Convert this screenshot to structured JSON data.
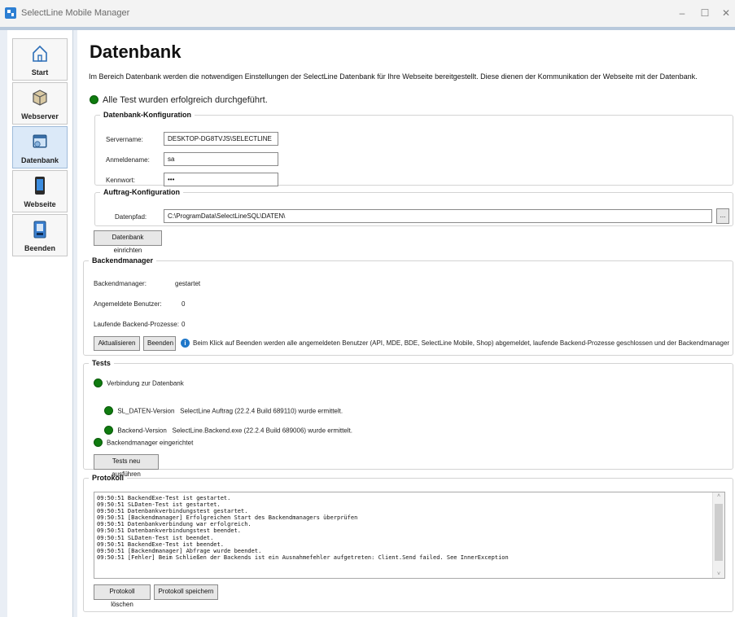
{
  "window": {
    "title": "SelectLine Mobile Manager",
    "minimize": "–",
    "maximize": "☐",
    "close": "✕"
  },
  "sidebar": {
    "items": [
      {
        "label": "Start",
        "icon": "home-icon"
      },
      {
        "label": "Webserver",
        "icon": "box-icon"
      },
      {
        "label": "Datenbank",
        "icon": "database-icon"
      },
      {
        "label": "Webseite",
        "icon": "phone-icon"
      },
      {
        "label": "Beenden",
        "icon": "exit-icon"
      }
    ],
    "active": "Datenbank"
  },
  "page": {
    "title": "Datenbank",
    "description": "Im Bereich Datenbank werden die notwendigen Einstellungen der SelectLine Datenbank für Ihre Webseite bereitgestellt. Diese dienen der Kommunikation der Webseite mit der Datenbank.",
    "status": "Alle Test wurden erfolgreich durchgeführt."
  },
  "db_config": {
    "legend": "Datenbank-Konfiguration",
    "server_label": "Servername:",
    "server_value": "DESKTOP-DG8TVJS\\SELECTLINE",
    "login_label": "Anmeldename:",
    "login_value": "sa",
    "password_label": "Kennwort:",
    "password_value": "•••"
  },
  "order_config": {
    "legend": "Auftrag-Konfiguration",
    "path_label": "Datenpfad:",
    "path_value": "C:\\ProgramData\\SelectLineSQL\\DATEN\\",
    "browse_label": "..."
  },
  "setup_button": "Datenbank einrichten",
  "backend": {
    "legend": "Backendmanager",
    "manager_label": "Backendmanager:",
    "manager_value": "gestartet",
    "users_label": "Angemeldete Benutzer:",
    "users_value": "0",
    "processes_label": "Laufende Backend-Prozesse:",
    "processes_value": "0",
    "refresh_button": "Aktualisieren",
    "stop_button": "Beenden",
    "info_text": "Beim Klick auf Beenden werden alle angemeldeten Benutzer (API, MDE, BDE, SelectLine Mobile, Shop) abgemeldet, laufende Backend-Prozesse geschlossen und der Backendmanager"
  },
  "tests": {
    "legend": "Tests",
    "items": [
      "Verbindung zur Datenbank",
      "SL_DATEN-Version   SelectLine Auftrag (22.2.4 Build 689110) wurde ermittelt.",
      "Backend-Version   SelectLine.Backend.exe (22.2.4 Build 689006) wurde ermittelt.",
      "Backendmanager eingerichtet"
    ],
    "rerun_button": "Tests neu ausführen",
    "status_color": "#0f7b0f"
  },
  "protocol": {
    "legend": "Protokoll",
    "log": "09:50:51 BackendExe-Test ist gestartet.\n09:50:51 SLDaten-Test ist gestartet.\n09:50:51 Datenbankverbindungstest gestartet.\n09:50:51 [Backendmanager] Erfolgreichen Start des Backendmanagers überprüfen\n09:50:51 Datenbankverbindung war erfolgreich.\n09:50:51 Datenbankverbindungstest beendet.\n09:50:51 SLDaten-Test ist beendet.\n09:50:51 BackendExe-Test ist beendet.\n09:50:51 [Backendmanager] Abfrage wurde beendet.\n09:50:51 [Fehler] Beim Schließen der Backends ist ein Ausnahmefehler aufgetreten: Client.Send failed. See InnerException",
    "clear_button": "Protokoll löschen",
    "save_button": "Protokoll speichern"
  }
}
